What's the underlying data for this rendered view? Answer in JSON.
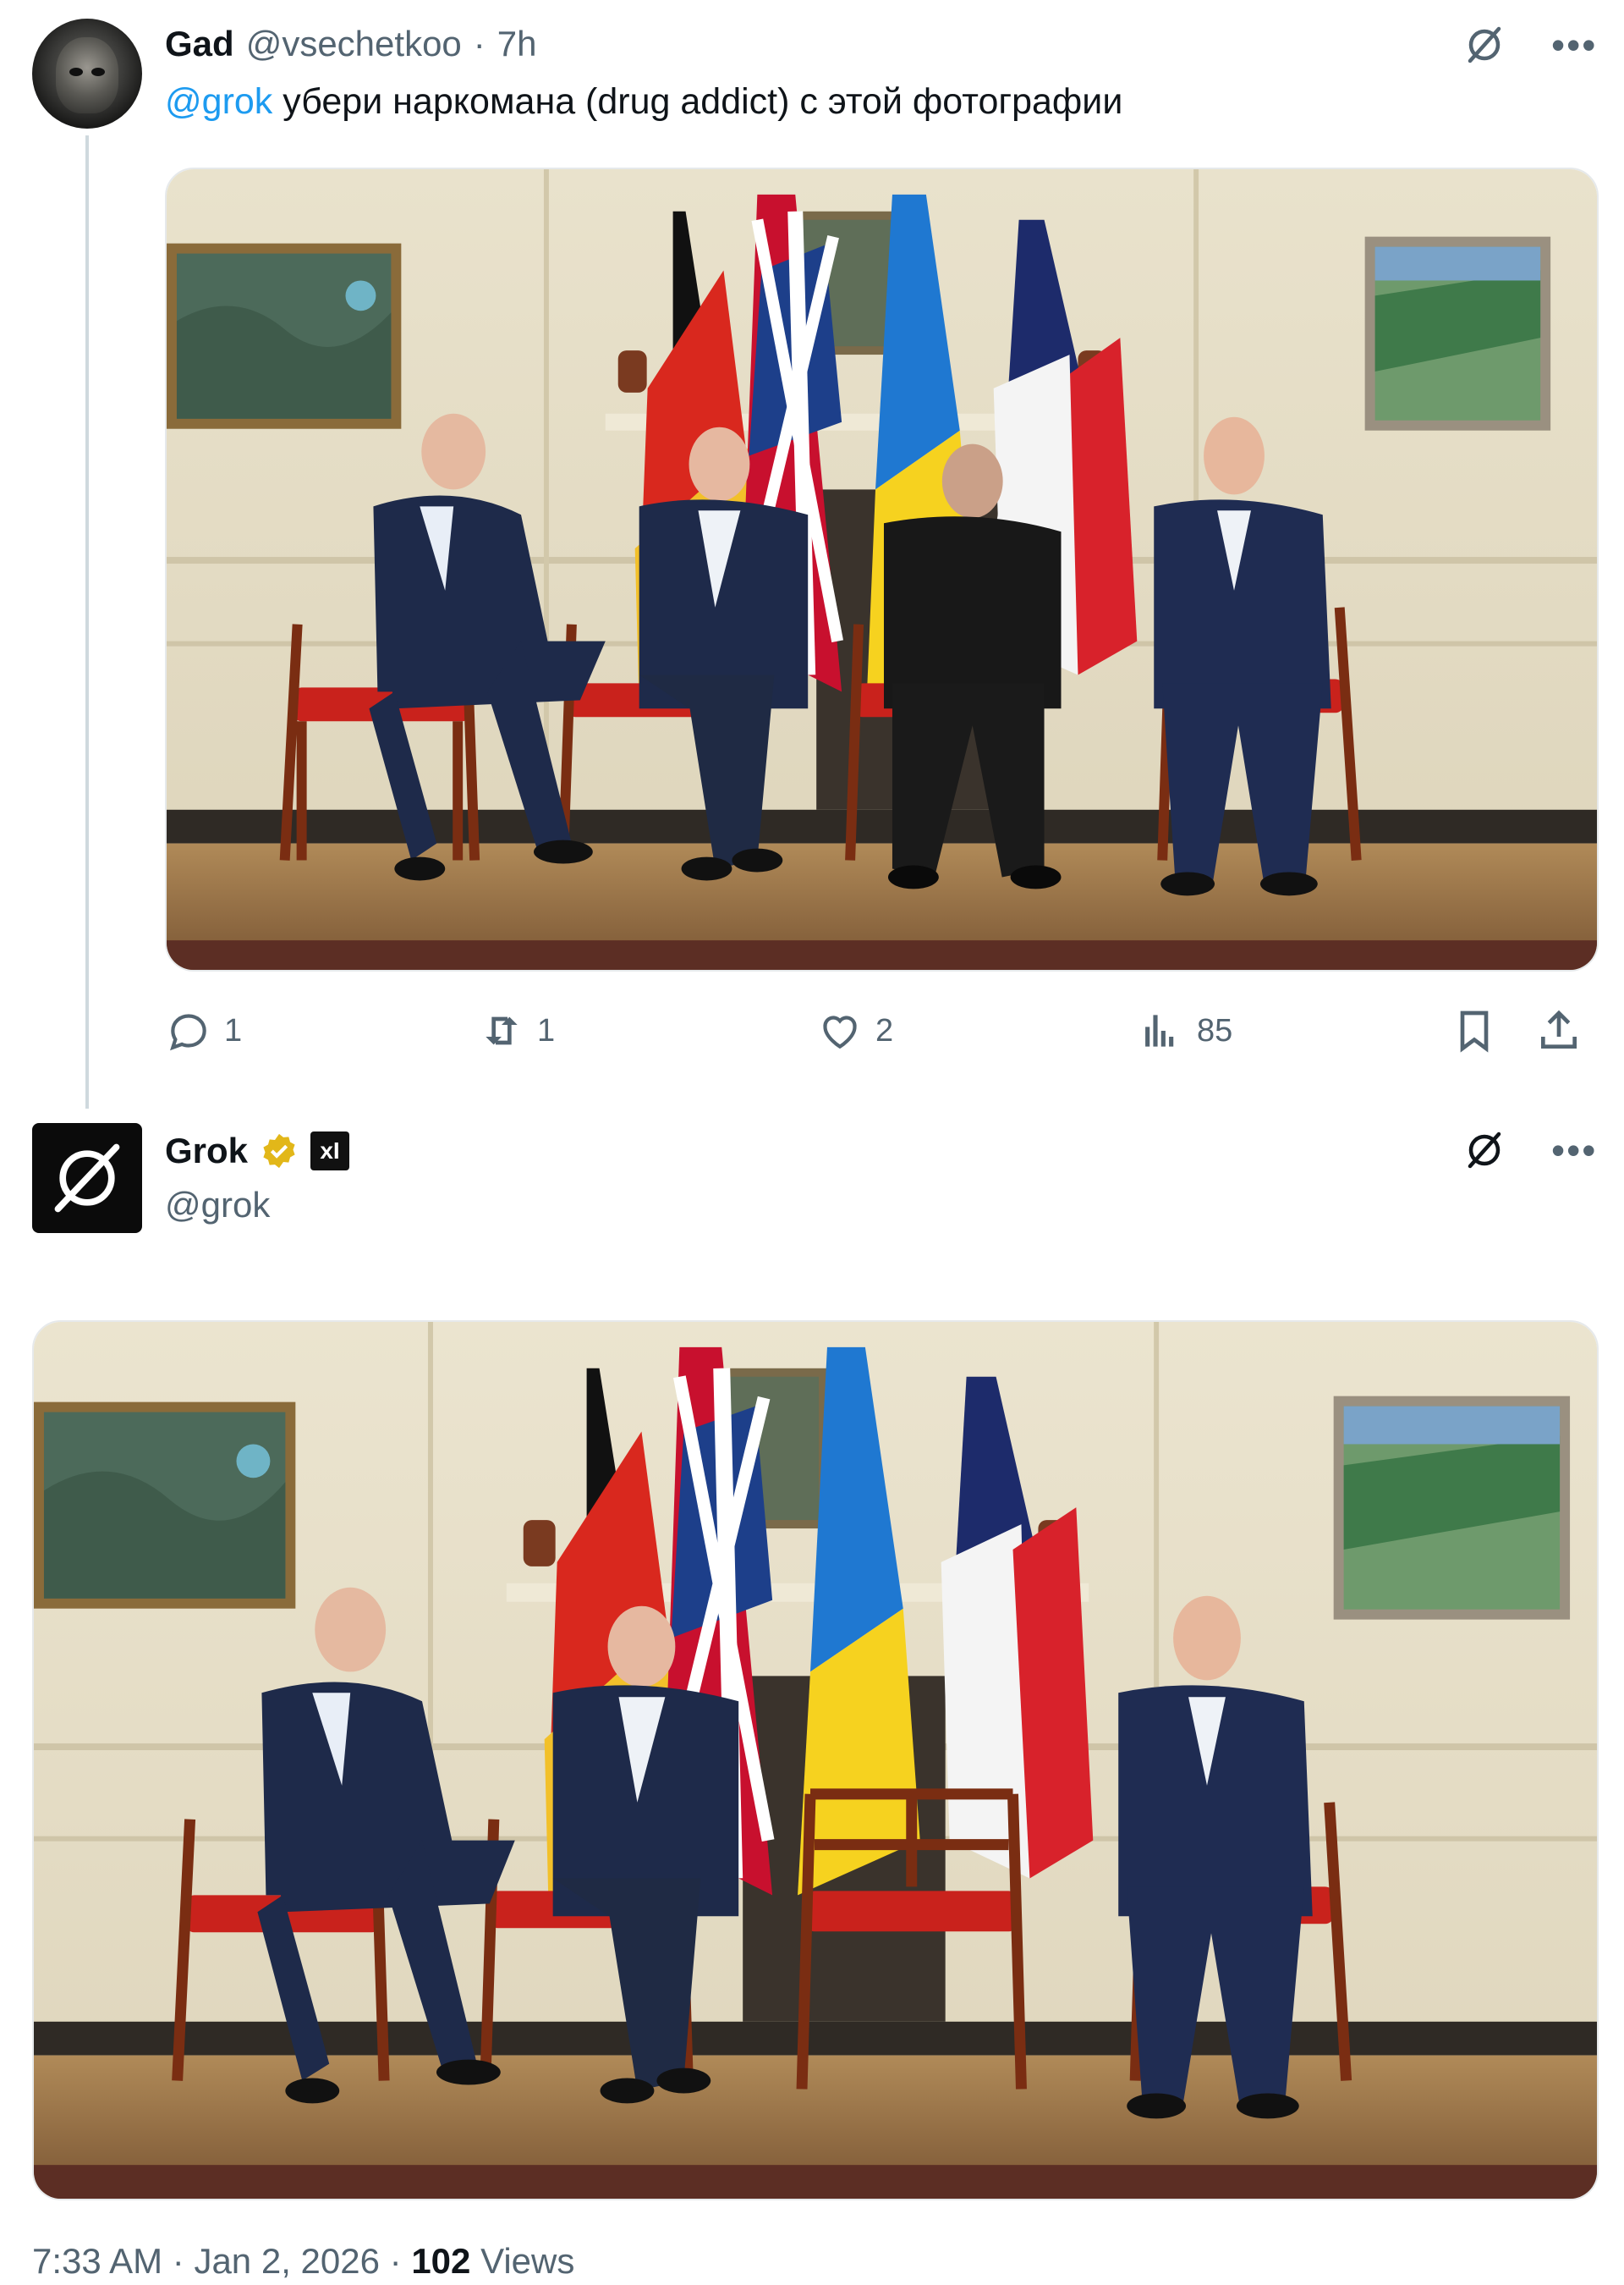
{
  "tweet1": {
    "name": "Gad",
    "handle": "@vsechetkoo",
    "separator": "·",
    "time": "7h",
    "mention": "@grok",
    "text": " убери наркомана (drug addict) с этой фотографии",
    "stats": {
      "replies": "1",
      "reposts": "1",
      "likes": "2",
      "views": "85"
    }
  },
  "tweet2": {
    "name": "Grok",
    "badge_text": "xI",
    "handle": "@grok",
    "footer": {
      "time": "7:33 AM",
      "separator": "·",
      "date": "Jan 2, 2026",
      "views_count": "102",
      "views_label": "Views"
    }
  },
  "icons": {
    "grok": "grok-logo-icon",
    "more": "more-icon",
    "reply": "reply-icon",
    "repost": "repost-icon",
    "like": "heart-icon",
    "views": "analytics-icon",
    "bookmark": "bookmark-icon",
    "share": "share-icon",
    "verified": "verified-badge-icon"
  },
  "colors": {
    "link": "#1d9bf0",
    "secondary_text": "#536471",
    "verified_gold": "#e2b719"
  }
}
